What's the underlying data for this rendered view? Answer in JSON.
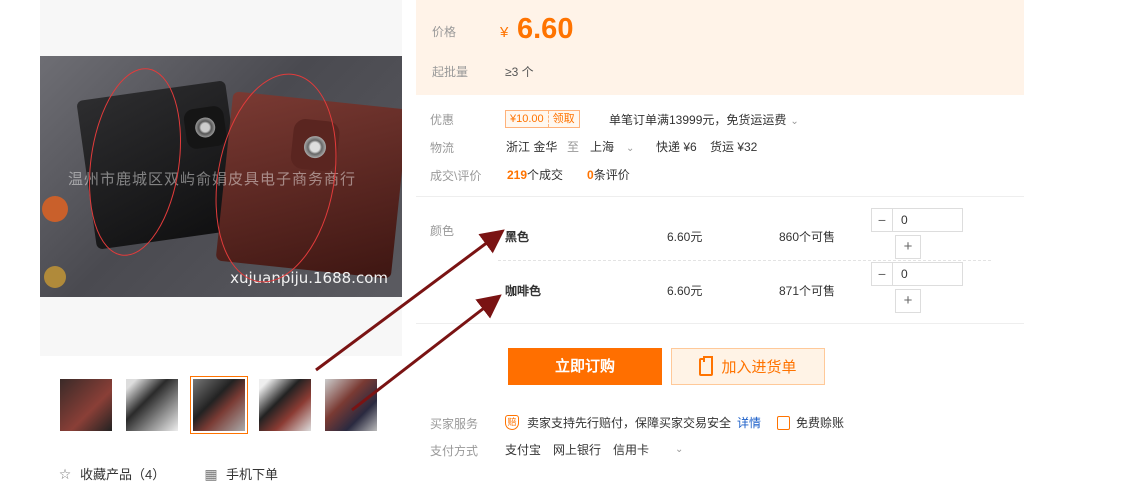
{
  "gallery": {
    "watermark": "温州市鹿城区双屿俞娟皮具电子商务商行",
    "site_url": "xujuanpiju.1688.com",
    "thumbnails": [
      "thumb-1",
      "thumb-2",
      "thumb-3",
      "thumb-4",
      "thumb-5"
    ],
    "active_thumbnail": 3,
    "collect_label": "收藏产品（4）",
    "mobile_label": "手机下单"
  },
  "price": {
    "label": "价格",
    "symbol": "¥",
    "value": "6.60",
    "moq_label": "起批量",
    "moq_value": "≥3 个"
  },
  "promo": {
    "label": "优惠",
    "coupon_amount": "¥10.00",
    "coupon_action": "领取",
    "discount_text": "单笔订单满13999元，免货运运费"
  },
  "logistics": {
    "label": "物流",
    "from": "浙江 金华",
    "to_word": "至",
    "to": "上海",
    "express": "快递 ¥6",
    "freight": "货运 ¥32"
  },
  "stats": {
    "label": "成交\\评价",
    "deals_num": "219",
    "deals_text": "个成交",
    "reviews_num": "0",
    "reviews_text": "条评价"
  },
  "sku": {
    "label": "颜色",
    "items": [
      {
        "name": "黑色",
        "price": "6.60元",
        "stock": "860个可售",
        "qty": "0"
      },
      {
        "name": "咖啡色",
        "price": "6.60元",
        "stock": "871个可售",
        "qty": "0"
      }
    ],
    "minus": "−",
    "plus": "+"
  },
  "actions": {
    "buy_now": "立即订购",
    "add_cart": "加入进货单"
  },
  "services": {
    "label": "买家服务",
    "guarantee": "卖家支持先行赔付，保障买家交易安全",
    "detail_link": "详情",
    "bill": "免费赊账",
    "shield_char": "赔"
  },
  "payment": {
    "label": "支付方式",
    "methods": [
      "支付宝",
      "网上银行",
      "信用卡"
    ]
  },
  "colors": {
    "accent": "#ff7300",
    "price_bg": "#fff3e8",
    "annotation_arrow": "#7a1313",
    "annotation_circle": "#e23b3b"
  }
}
